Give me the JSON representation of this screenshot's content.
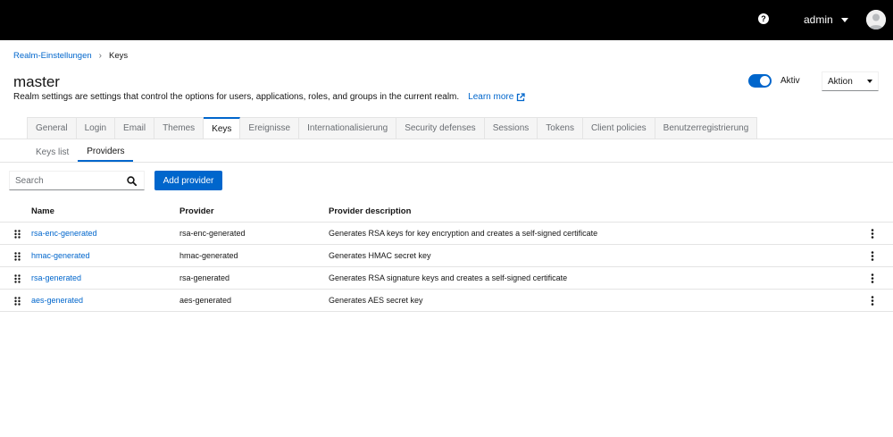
{
  "masthead": {
    "help_icon": "question-circle-icon",
    "username": "admin"
  },
  "breadcrumb": {
    "parent": "Realm-Einstellungen",
    "current": "Keys"
  },
  "header": {
    "title": "master",
    "description": "Realm settings are settings that control the options for users, applications, roles, and groups in the current realm.",
    "learn_more": "Learn more",
    "enabled_label": "Aktiv",
    "action_label": "Aktion"
  },
  "tabs": [
    {
      "label": "General"
    },
    {
      "label": "Login"
    },
    {
      "label": "Email"
    },
    {
      "label": "Themes"
    },
    {
      "label": "Keys",
      "active": true
    },
    {
      "label": "Ereignisse"
    },
    {
      "label": "Internationalisierung"
    },
    {
      "label": "Security defenses"
    },
    {
      "label": "Sessions"
    },
    {
      "label": "Tokens"
    },
    {
      "label": "Client policies"
    },
    {
      "label": "Benutzerregistrierung"
    }
  ],
  "subtabs": [
    {
      "label": "Keys list"
    },
    {
      "label": "Providers",
      "active": true
    }
  ],
  "toolbar": {
    "search_placeholder": "Search",
    "add_provider": "Add provider"
  },
  "table": {
    "columns": [
      "Name",
      "Provider",
      "Provider description"
    ],
    "rows": [
      {
        "name": "rsa-enc-generated",
        "provider": "rsa-enc-generated",
        "description": "Generates RSA keys for key encryption and creates a self-signed certificate"
      },
      {
        "name": "hmac-generated",
        "provider": "hmac-generated",
        "description": "Generates HMAC secret key"
      },
      {
        "name": "rsa-generated",
        "provider": "rsa-generated",
        "description": "Generates RSA signature keys and creates a self-signed certificate"
      },
      {
        "name": "aes-generated",
        "provider": "aes-generated",
        "description": "Generates AES secret key"
      }
    ]
  },
  "colors": {
    "accent": "#0066cc",
    "masthead": "#000000",
    "border": "#e4e4e4"
  }
}
